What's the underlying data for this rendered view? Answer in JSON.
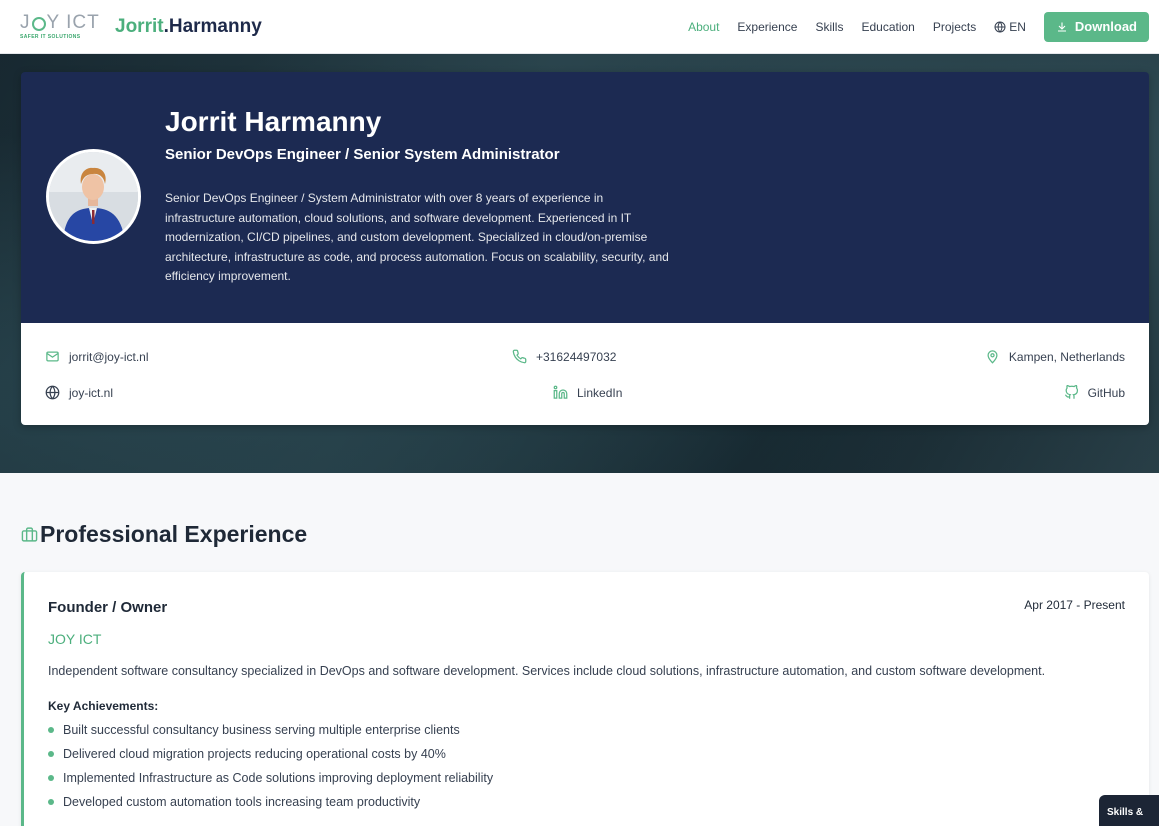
{
  "header": {
    "logo_text": "JOY ICT",
    "logo_tagline": "SAFER IT SOLUTIONS",
    "brand_first": "Jorrit",
    "brand_last": ".Harmanny",
    "nav": [
      "About",
      "Experience",
      "Skills",
      "Education",
      "Projects"
    ],
    "active_nav": "About",
    "language": "EN",
    "download_label": "Download"
  },
  "profile": {
    "name": "Jorrit Harmanny",
    "title": "Senior DevOps Engineer / Senior System Administrator",
    "summary": "Senior DevOps Engineer / System Administrator with over 8 years of experience in infrastructure automation, cloud solutions, and software development. Experienced in IT modernization, CI/CD pipelines, and custom development. Specialized in cloud/on-premise architecture, infrastructure as code, and process automation. Focus on scalability, security, and efficiency improvement.",
    "contacts": {
      "email": "jorrit@joy-ict.nl",
      "phone": "+31624497032",
      "location": "Kampen, Netherlands",
      "website": "joy-ict.nl",
      "linkedin": "LinkedIn",
      "github": "GitHub"
    }
  },
  "experience": {
    "section_title": "Professional Experience",
    "jobs": [
      {
        "role": "Founder / Owner",
        "date": "Apr 2017 - Present",
        "company": "JOY ICT",
        "description": "Independent software consultancy specialized in DevOps and software development. Services include cloud solutions, infrastructure automation, and custom software development.",
        "achievements_title": "Key Achievements:",
        "achievements": [
          "Built successful consultancy business serving multiple enterprise clients",
          "Delivered cloud migration projects reducing operational costs by 40%",
          "Implemented Infrastructure as Code solutions improving deployment reliability",
          "Developed custom automation tools increasing team productivity"
        ]
      }
    ]
  },
  "widget": {
    "label": "Skills &"
  },
  "colors": {
    "accent": "#5bb889",
    "navy": "#1c2a52"
  }
}
